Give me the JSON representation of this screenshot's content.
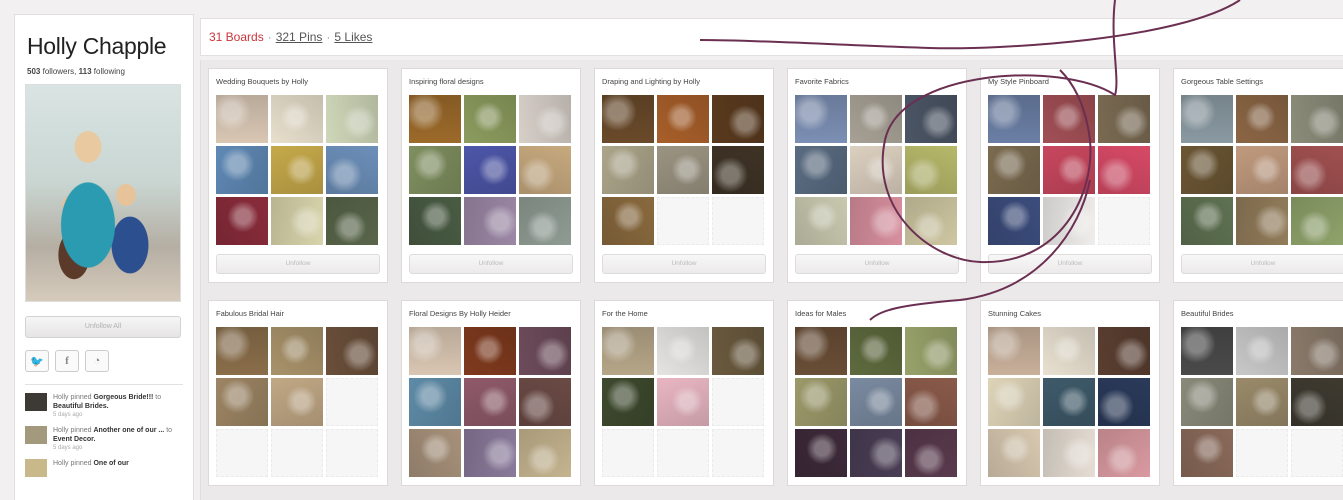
{
  "profile": {
    "name": "Holly Chapple",
    "followers_count": "503",
    "followers_label": "followers",
    "following_count": "113",
    "following_label": "following",
    "follow_button": "Unfollow All",
    "social_icons": [
      "twitter-icon",
      "facebook-icon",
      "rss-icon"
    ],
    "activity": [
      {
        "pre": "Holly pinned ",
        "bold1": "Gorgeous Bride!!!",
        "mid": " to ",
        "bold2": "Beautiful Brides.",
        "time": "5 days ago",
        "color": "#3d3a36"
      },
      {
        "pre": "Holly pinned ",
        "bold1": "Another one of our ...",
        "mid": " to ",
        "bold2": "Event Decor.",
        "time": "5 days ago",
        "color": "#a39a7e"
      },
      {
        "pre": "Holly pinned ",
        "bold1": "One of our",
        "mid": "",
        "bold2": "",
        "time": "",
        "color": "#c9b98a"
      }
    ]
  },
  "topbar": {
    "boards": "31 Boards",
    "sep": "·",
    "pins": "321 Pins",
    "likes": "5 Likes"
  },
  "boards": [
    {
      "title": "Wedding Bouquets by Holly",
      "follow": "Unfollow",
      "colors": [
        "#d9c7b4",
        "#e8dfcc",
        "#cfd7b9",
        "#5f89b5",
        "#c6a94a",
        "#6c8fb9",
        "#8a2c3b",
        "#d8d4ab",
        "#59664a"
      ]
    },
    {
      "title": "Inspiring floral designs",
      "follow": "Unfollow",
      "colors": [
        "#9c6a2a",
        "#8c9c5e",
        "#d7cfc8",
        "#7f8f5f",
        "#4d56a8",
        "#c7a97e",
        "#4a5c44",
        "#9c88a6",
        "#8f9c93"
      ]
    },
    {
      "title": "Draping and Lighting by Holly",
      "follow": "Unfollow",
      "colors": [
        "#6a4a2a",
        "#a85f2a",
        "#5a3a1e",
        "#aca58a",
        "#9b9482",
        "#3e3325",
        "#8a6a3e",
        "empty",
        "empty"
      ]
    },
    {
      "title": "Favorite Fabrics",
      "follow": "Unfollow",
      "colors": [
        "#7c8fb4",
        "#a7a195",
        "#4b5565",
        "#5a6c82",
        "#dcd0c0",
        "#b6b86a",
        "#c9c9b0",
        "#d88f9e",
        "#cfc7a2"
      ]
    },
    {
      "title": "My Style Pinboard",
      "follow": "Unfollow",
      "colors": [
        "#6b7fa5",
        "#a14f55",
        "#7a6a52",
        "#7b6b50",
        "#c8475e",
        "#d74a66",
        "#3c4d7d",
        "#f0eeec",
        "empty"
      ]
    },
    {
      "title": "Gorgeous Table Settings",
      "follow": "Unfollow",
      "colors": [
        "#8a9aa2",
        "#8b6645",
        "#8c8c7a",
        "#6b5634",
        "#c09a7e",
        "#a15050",
        "#5f7252",
        "#927c5a",
        "#8fa36b"
      ]
    },
    {
      "title": "Fabulous Bridal Hair",
      "follow": "Unfollow",
      "colors": [
        "#8a6e4a",
        "#a8926a",
        "#6a4f3a",
        "#9d8564",
        "#c1a885",
        "empty",
        "empty",
        "empty",
        "empty"
      ]
    },
    {
      "title": "Floral Designs By Holly Heider",
      "follow": "Unfollow",
      "colors": [
        "#d9c6b2",
        "#7f3a1e",
        "#6d4b5a",
        "#5e8ba8",
        "#8f5a6a",
        "#6b4a45",
        "#a7917a",
        "#8a7a9b",
        "#c5b48f"
      ]
    },
    {
      "title": "For the Home",
      "follow": "Unfollow",
      "colors": [
        "#b6a688",
        "#e6e4e2",
        "#6a5a3e",
        "#3e4a2e",
        "#e8b6c2",
        "empty",
        "empty",
        "empty",
        "empty"
      ]
    },
    {
      "title": "Ideas for Males",
      "follow": "Unfollow",
      "colors": [
        "#6a4e36",
        "#5e6a3e",
        "#98a26a",
        "#9c9a6a",
        "#7a8aa0",
        "#8a5a4a",
        "#3e2a3a",
        "#4a3e55",
        "#5a3a4e"
      ]
    },
    {
      "title": "Stunning Cakes",
      "follow": "Unfollow",
      "colors": [
        "#c8b09a",
        "#e8e0d0",
        "#5a3e30",
        "#ded4b8",
        "#3e5a6a",
        "#2a3a5a",
        "#d8c8b0",
        "#e6ded4",
        "#d99aa0"
      ]
    },
    {
      "title": "Beautiful Brides",
      "follow": "Unfollow",
      "colors": [
        "#4a4a4a",
        "#c8c8c8",
        "#8a7a6a",
        "#8a8a7a",
        "#9a8a6a",
        "#3e3a30",
        "#8a6a5a",
        "empty",
        "empty"
      ]
    }
  ],
  "annotation_color": "#6b2f52"
}
